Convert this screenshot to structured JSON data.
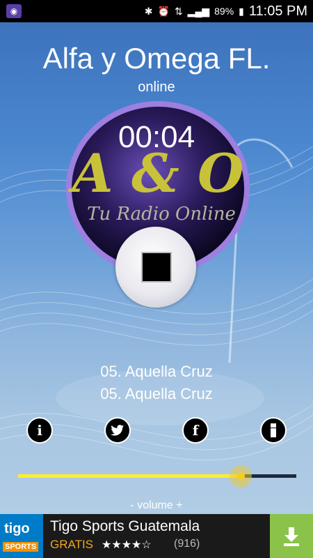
{
  "status_bar": {
    "battery": "89%",
    "time": "11:05 PM",
    "icons": [
      "bluetooth-icon",
      "alarm-icon",
      "data-icon",
      "signal-icon",
      "battery-icon"
    ]
  },
  "station": {
    "name": "Alfa y Omega FL.",
    "status": "online",
    "elapsed": "00:04",
    "logo_main": "A & O",
    "logo_tagline": "Tu Radio Online"
  },
  "track": {
    "line1": "05. Aquella Cruz",
    "line2": "05. Aquella Cruz"
  },
  "actions": {
    "info": "i",
    "twitter": "twitter",
    "facebook": "f",
    "menu": "menu"
  },
  "volume": {
    "label": "- volume +",
    "level": 0.8
  },
  "ad": {
    "brand_top": "tigo",
    "brand_bottom": "SPORTS",
    "title": "Tigo Sports Guatemala",
    "price": "GRATIS",
    "rating_stars": "★★★★☆",
    "rating_count": "(916)"
  },
  "colors": {
    "slider_fill": "#ffef2a",
    "ad_price": "#f2a71b",
    "download": "#8bc34a"
  }
}
